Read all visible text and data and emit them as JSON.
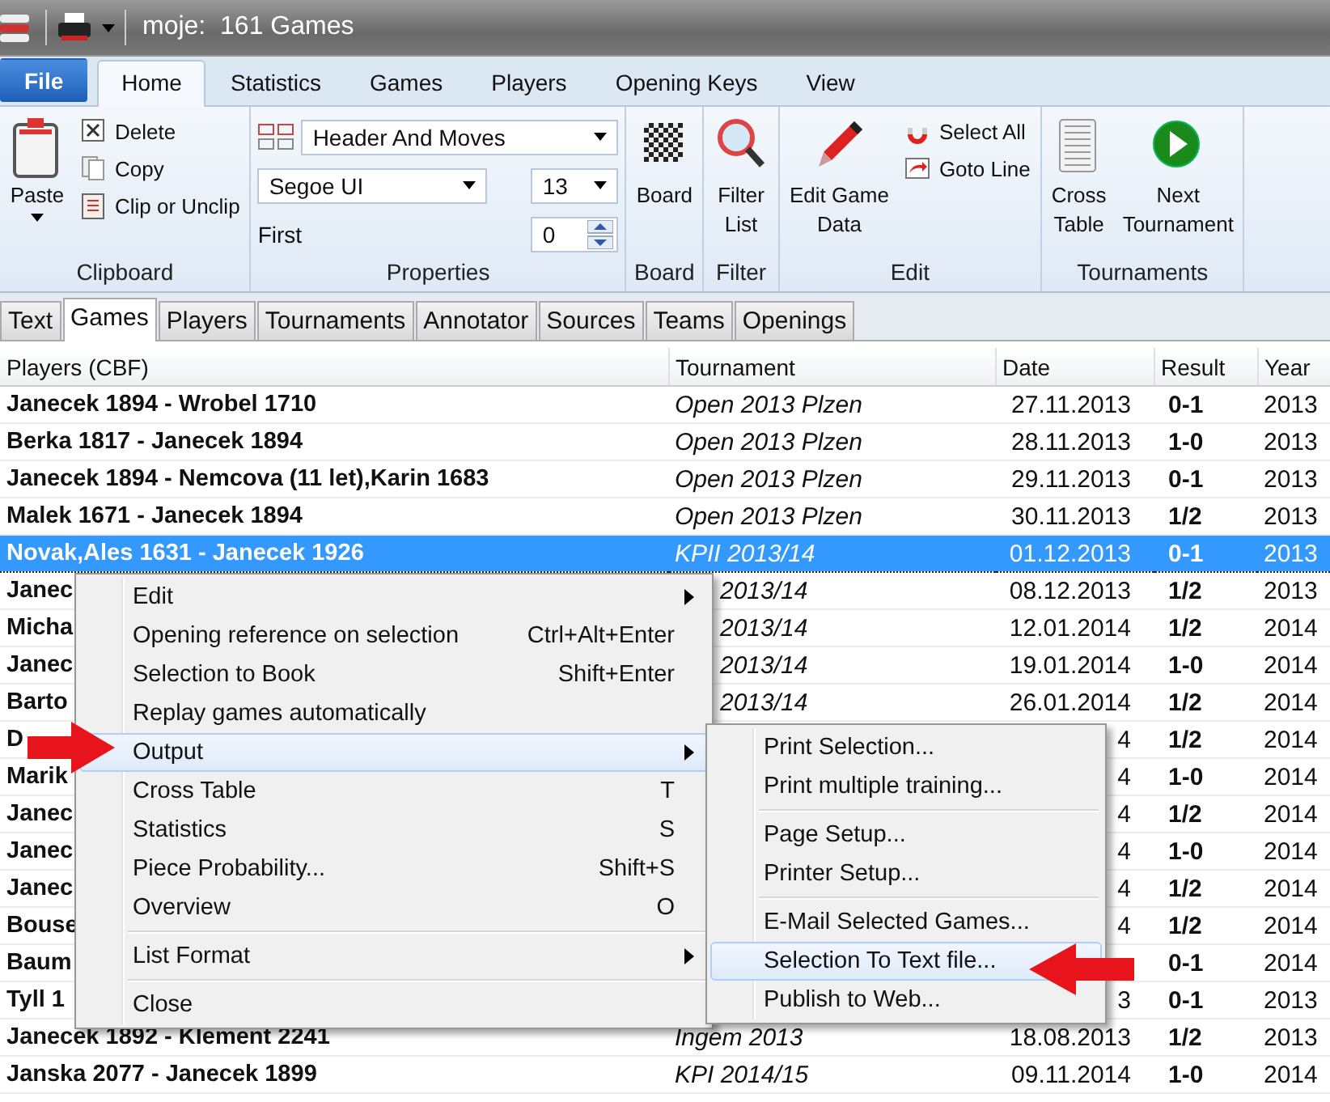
{
  "window": {
    "title": "moje:  161 Games"
  },
  "ribbon_tabs": [
    {
      "label": "File",
      "kind": "file",
      "selected": false
    },
    {
      "label": "Home",
      "kind": "tab",
      "selected": true
    },
    {
      "label": "Statistics",
      "kind": "tab",
      "selected": false
    },
    {
      "label": "Games",
      "kind": "tab",
      "selected": false
    },
    {
      "label": "Players",
      "kind": "tab",
      "selected": false
    },
    {
      "label": "Opening Keys",
      "kind": "tab",
      "selected": false
    },
    {
      "label": "View",
      "kind": "tab",
      "selected": false
    }
  ],
  "ribbon_groups": [
    {
      "label": "Clipboard",
      "kind": "buttons",
      "large": [
        {
          "label": "Paste",
          "menu": true
        }
      ],
      "small": [
        "Delete",
        "Copy",
        "Clip or Unclip"
      ]
    },
    {
      "label": "Properties",
      "kind": "properties",
      "format": "Header And Moves",
      "font": "Segoe UI",
      "size": "13",
      "first_label": "First",
      "first_value": "0"
    },
    {
      "label": "Board",
      "kind": "buttons",
      "large": [
        {
          "label": "Board",
          "menu": false
        }
      ]
    },
    {
      "label": "Filter",
      "kind": "buttons",
      "large": [
        {
          "label": "Filter\nList",
          "menu": false
        }
      ]
    },
    {
      "label": "Edit",
      "kind": "buttons",
      "large": [
        {
          "label": "Edit Game\nData",
          "menu": false
        }
      ],
      "small": [
        "Select All",
        "Goto Line"
      ]
    },
    {
      "label": "Tournaments",
      "kind": "buttons",
      "large": [
        {
          "label": "Cross\nTable",
          "menu": false
        },
        {
          "label": "Next\nTournament",
          "menu": false
        }
      ]
    }
  ],
  "doc_tabs": [
    {
      "label": "Text",
      "selected": false
    },
    {
      "label": "Games",
      "selected": true
    },
    {
      "label": "Players",
      "selected": false
    },
    {
      "label": "Tournaments",
      "selected": false
    },
    {
      "label": "Annotator",
      "selected": false
    },
    {
      "label": "Sources",
      "selected": false
    },
    {
      "label": "Teams",
      "selected": false
    },
    {
      "label": "Openings",
      "selected": false
    }
  ],
  "table": {
    "columns": [
      "Players (CBF)",
      "Tournament",
      "Date",
      "Result",
      "Year"
    ],
    "rows": [
      {
        "players": "Janecek 1894 - Wrobel 1710",
        "tournament": "Open 2013 Plzen",
        "date": "27.11.2013",
        "result": "0-1",
        "year": "2013",
        "selected": false,
        "partly_hidden": false
      },
      {
        "players": "Berka 1817 - Janecek 1894",
        "tournament": "Open 2013 Plzen",
        "date": "28.11.2013",
        "result": "1-0",
        "year": "2013",
        "selected": false,
        "partly_hidden": false
      },
      {
        "players": "Janecek 1894 - Nemcova (11 let),Karin 1683",
        "tournament": "Open 2013 Plzen",
        "date": "29.11.2013",
        "result": "0-1",
        "year": "2013",
        "selected": false,
        "partly_hidden": false
      },
      {
        "players": "Malek 1671 - Janecek 1894",
        "tournament": "Open 2013 Plzen",
        "date": "30.11.2013",
        "result": "1/2",
        "year": "2013",
        "selected": false,
        "partly_hidden": false
      },
      {
        "players": "Novak,Ales 1631 - Janecek 1926",
        "tournament": "KPII 2013/14",
        "date": "01.12.2013",
        "result": "0-1",
        "year": "2013",
        "selected": true,
        "partly_hidden": false
      },
      {
        "players": "Janec",
        "tournament": "2013/14",
        "date": "08.12.2013",
        "result": "1/2",
        "year": "2013",
        "selected": false,
        "partly_hidden": true
      },
      {
        "players": "Micha",
        "tournament": "2013/14",
        "date": "12.01.2014",
        "result": "1/2",
        "year": "2014",
        "selected": false,
        "partly_hidden": true
      },
      {
        "players": "Janec",
        "tournament": "2013/14",
        "date": "19.01.2014",
        "result": "1-0",
        "year": "2014",
        "selected": false,
        "partly_hidden": true
      },
      {
        "players": "Barto",
        "tournament": "2013/14",
        "date": "26.01.2014",
        "result": "1/2",
        "year": "2014",
        "selected": false,
        "partly_hidden": true
      },
      {
        "players": "D",
        "date": "4",
        "result": "1/2",
        "year": "2014",
        "selected": false
      },
      {
        "players": "Marik",
        "date": "4",
        "result": "1-0",
        "year": "2014",
        "selected": false
      },
      {
        "players": "Janec",
        "date": "4",
        "result": "1/2",
        "year": "2014",
        "selected": false
      },
      {
        "players": "Janec",
        "date": "4",
        "result": "1-0",
        "year": "2014",
        "selected": false
      },
      {
        "players": "Janec",
        "date": "4",
        "result": "1/2",
        "year": "2014",
        "selected": false
      },
      {
        "players": "Bouse",
        "date": "4",
        "result": "1/2",
        "year": "2014",
        "selected": false
      },
      {
        "players": "Baum",
        "result": "0-1",
        "year": "2014",
        "selected": false
      },
      {
        "players": "Tyll 1",
        "date": "3",
        "result": "0-1",
        "year": "2013",
        "selected": false
      },
      {
        "players": "Janecek 1892 - Klement 2241",
        "tournament": "Ingem 2013",
        "date": "18.08.2013",
        "result": "1/2",
        "year": "2013",
        "selected": false,
        "partly_hidden": false
      },
      {
        "players": "Janska 2077 - Janecek 1899",
        "tournament": "KPI 2014/15",
        "date": "09.11.2014",
        "result": "1-0",
        "year": "2014",
        "selected": false,
        "partly_hidden": false
      }
    ]
  },
  "context_menu": {
    "items": [
      {
        "kind": "item",
        "label": "Edit",
        "has_submenu": true,
        "selected": false
      },
      {
        "kind": "item",
        "label": "Opening reference on selection",
        "shortcut": "Ctrl+Alt+Enter",
        "has_submenu": false,
        "selected": false
      },
      {
        "kind": "item",
        "label": "Selection to Book",
        "shortcut": "Shift+Enter",
        "has_submenu": false,
        "selected": false
      },
      {
        "kind": "item",
        "label": "Replay games automatically",
        "has_submenu": false,
        "selected": false
      },
      {
        "kind": "item",
        "label": "Output",
        "has_submenu": true,
        "selected": true
      },
      {
        "kind": "item",
        "label": "Cross Table",
        "shortcut": "T",
        "has_submenu": false,
        "selected": false
      },
      {
        "kind": "item",
        "label": "Statistics",
        "shortcut": "S",
        "has_submenu": false,
        "selected": false
      },
      {
        "kind": "item",
        "label": "Piece Probability...",
        "shortcut": "Shift+S",
        "has_submenu": false,
        "selected": false
      },
      {
        "kind": "item",
        "label": "Overview",
        "shortcut": "O",
        "has_submenu": false,
        "selected": false
      },
      {
        "kind": "separator"
      },
      {
        "kind": "item",
        "label": "List Format",
        "has_submenu": true,
        "selected": false
      },
      {
        "kind": "separator"
      },
      {
        "kind": "item",
        "label": "Close",
        "has_submenu": false,
        "selected": false
      }
    ]
  },
  "submenu": {
    "items": [
      {
        "kind": "item",
        "label": "Print Selection...",
        "has_submenu": false,
        "selected": false
      },
      {
        "kind": "item",
        "label": "Print multiple training...",
        "has_submenu": false,
        "selected": false
      },
      {
        "kind": "separator"
      },
      {
        "kind": "item",
        "label": "Page Setup...",
        "has_submenu": false,
        "selected": false
      },
      {
        "kind": "item",
        "label": "Printer Setup...",
        "has_submenu": false,
        "selected": false
      },
      {
        "kind": "separator"
      },
      {
        "kind": "item",
        "label": "E-Mail Selected Games...",
        "has_submenu": false,
        "selected": false
      },
      {
        "kind": "item",
        "label": "Selection To Text file...",
        "has_submenu": false,
        "selected": true
      },
      {
        "kind": "item",
        "label": "Publish to Web...",
        "has_submenu": false,
        "selected": false
      }
    ]
  }
}
